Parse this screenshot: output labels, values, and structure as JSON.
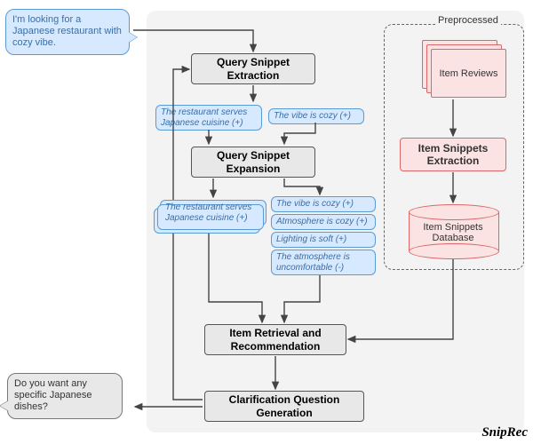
{
  "section_label": "Preprocessed",
  "brand": "SnipRec",
  "user_query_bubble": "I'm looking for a Japanese restaurant with cozy vibe.",
  "clarification_bubble": "Do you want any specific Japanese dishes?",
  "processes": {
    "query_extract": "Query Snippet\nExtraction",
    "query_expand": "Query Snippet\nExpansion",
    "item_retrieval": "Item Retrieval and\nRecommendation",
    "clarif_gen": "Clarification Question\nGeneration",
    "item_reviews": "Item Reviews",
    "item_snip_extract": "Item Snippets\nExtraction",
    "item_snip_db": "Item Snippets\nDatabase"
  },
  "extract_snippets": [
    "The restaurant serves Japanese cuisine (+)",
    "The vibe is cozy (+)"
  ],
  "expand_snippets_col1": [
    "The restaurant serves Japanese cuisine (+)"
  ],
  "expand_snippets_col2": [
    "The vibe is cozy (+)",
    "Atmosphere is cozy (+)",
    "Lighting is soft (+)",
    "The atmosphere is uncomfortable (-)"
  ]
}
